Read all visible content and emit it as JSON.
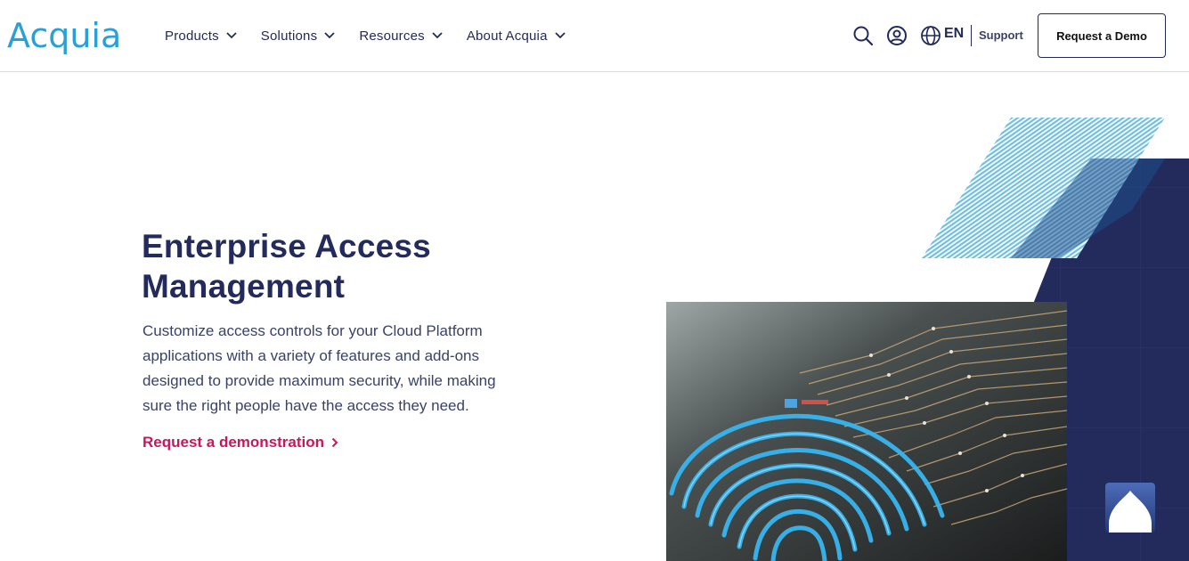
{
  "brand": {
    "logo_text": "Acquia",
    "logo_color": "#2b9fd8"
  },
  "nav": {
    "items": [
      {
        "label": "Products"
      },
      {
        "label": "Solutions"
      },
      {
        "label": "Resources"
      },
      {
        "label": "About Acquia"
      }
    ]
  },
  "header_actions": {
    "search_icon": "search-icon",
    "account_icon": "user-circle-icon",
    "language_icon": "globe-icon",
    "language": "EN",
    "support_label": "Support",
    "demo_button_label": "Request a Demo"
  },
  "hero": {
    "title": "Enterprise Access Management",
    "description": "Customize access controls for your Cloud Platform applications with a variety of features and add-ons designed to provide maximum security, while making sure the right people have the access they need.",
    "cta_label": "Request a demonstration",
    "cta_color": "#c8175d",
    "title_color": "#232a5c",
    "accent_navy": "#232a5c",
    "accent_light_blue": "#7cc6e8"
  },
  "chat_widget": {
    "icon": "chat-bubble-icon"
  }
}
